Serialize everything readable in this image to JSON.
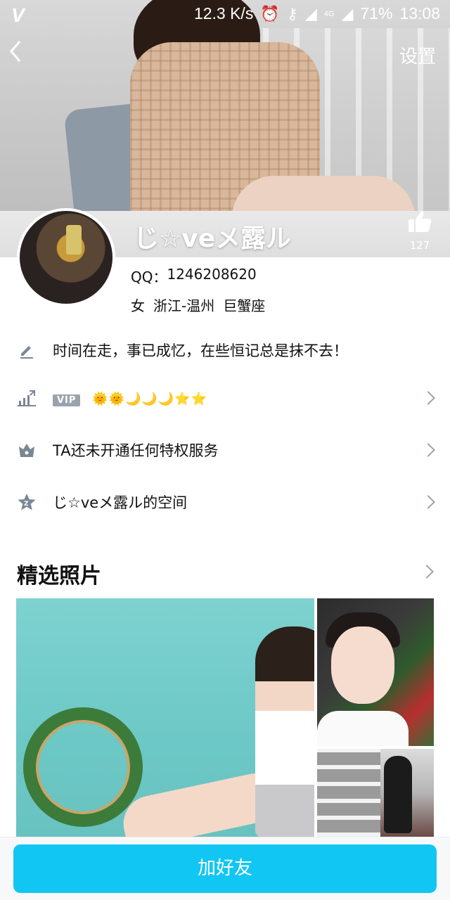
{
  "status_bar": {
    "app_icon": "V",
    "speed": "12.3 K/s",
    "battery": "71%",
    "time": "13:08",
    "network": "4G"
  },
  "header": {
    "back_icon": "chevron-left-icon",
    "settings_label": "设置",
    "nickname": "じ☆veメ露ル",
    "likes": "127"
  },
  "profile": {
    "qq_label": "QQ：",
    "qq_number": "1246208620",
    "gender": "女",
    "location": "浙江-温州",
    "zodiac": "巨蟹座"
  },
  "rows": {
    "signature": "时间在走，事已成忆，在些恒记总是抹不去！",
    "vip_badge": "VIP",
    "level_icons": "🌞🌞🌙🌙🌙⭐⭐",
    "privilege": "TA还未开通任何特权服务",
    "space": "じ☆veメ露ル的空间"
  },
  "photos": {
    "title": "精选照片"
  },
  "bottom": {
    "add_friend_label": "加好友"
  },
  "colors": {
    "accent": "#12c6f3",
    "icon_gray": "#7a8794",
    "chevron_gray": "#9aa3ad"
  }
}
